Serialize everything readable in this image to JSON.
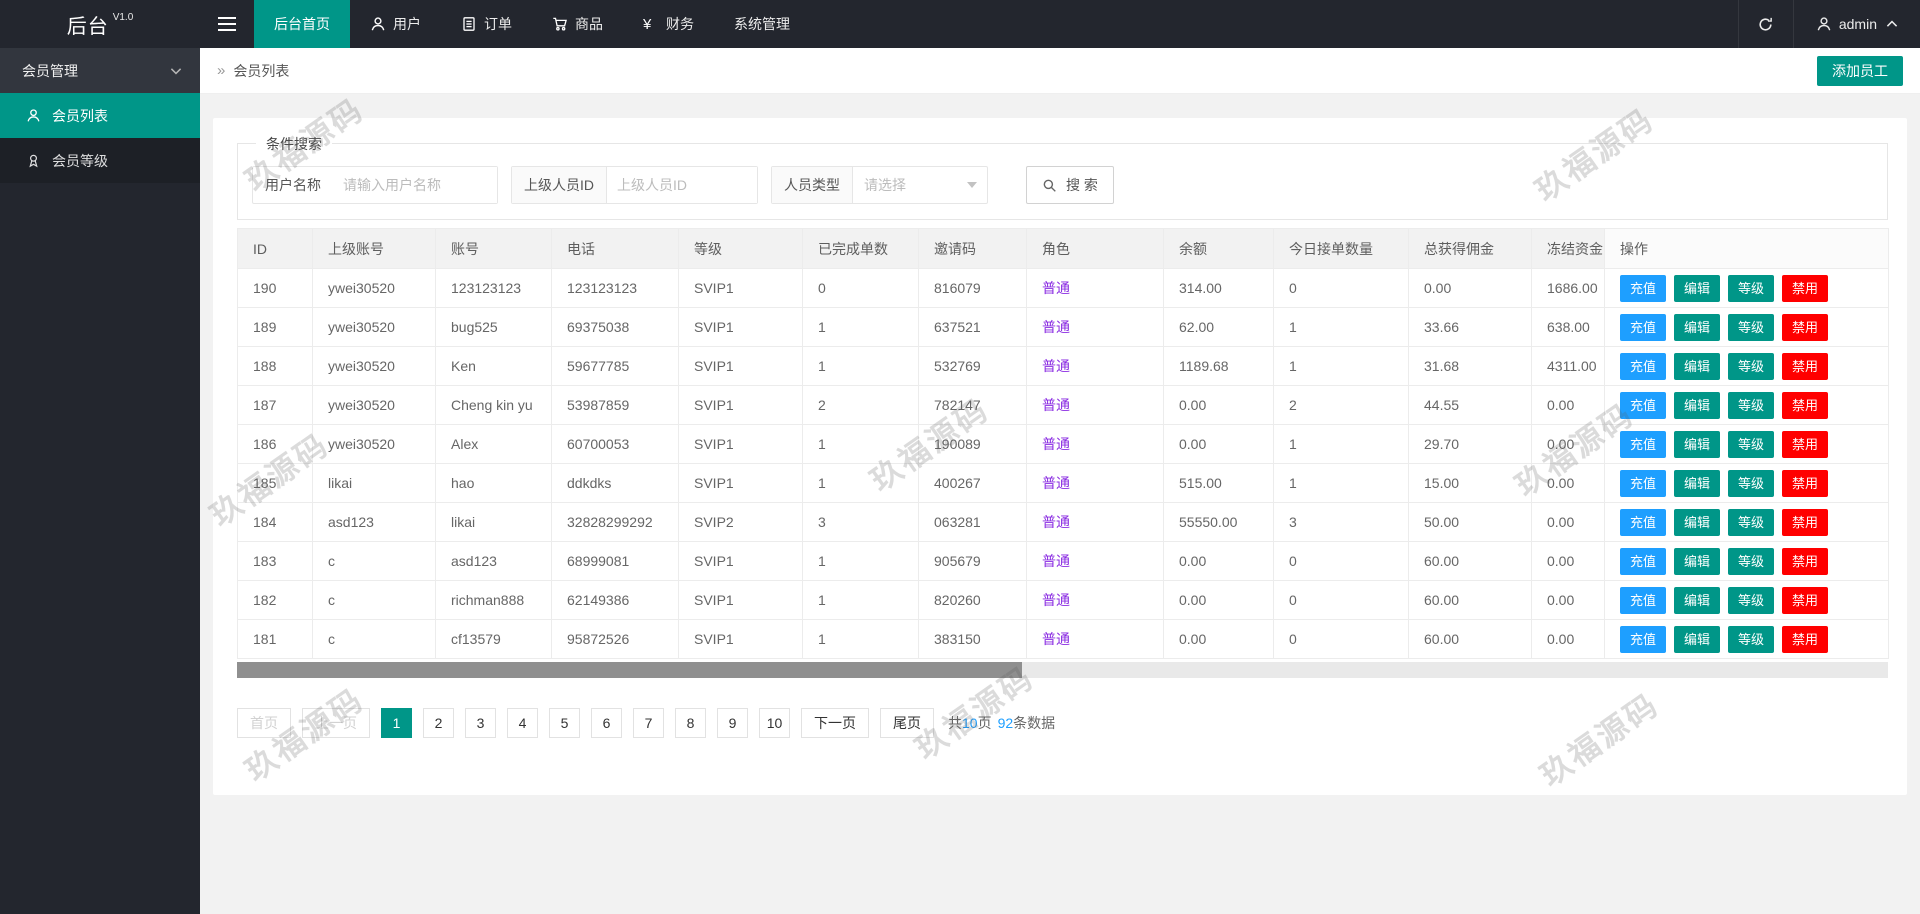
{
  "app": {
    "name": "后台",
    "version": "V1.0"
  },
  "navbar": {
    "items": [
      {
        "label": "后台首页",
        "icon": "",
        "active": true
      },
      {
        "label": "用户",
        "icon": "user",
        "active": false
      },
      {
        "label": "订单",
        "icon": "document",
        "active": false
      },
      {
        "label": "商品",
        "icon": "cart",
        "active": false
      },
      {
        "label": "财务",
        "icon": "yen",
        "active": false
      },
      {
        "label": "系统管理",
        "icon": "",
        "active": false
      }
    ],
    "user": {
      "name": "admin"
    }
  },
  "sidebar": {
    "groups": [
      {
        "label": "会员管理",
        "items": [
          {
            "label": "会员列表",
            "icon": "user",
            "active": true
          },
          {
            "label": "会员等级",
            "icon": "medal",
            "active": false
          }
        ]
      }
    ]
  },
  "breadcrumb": {
    "separator": "»",
    "label": "会员列表"
  },
  "toolbar": {
    "add_button": "添加员工"
  },
  "search": {
    "legend": "条件搜索",
    "fields": [
      {
        "label": "用户名称",
        "placeholder": "请输入用户名称",
        "type": "text"
      },
      {
        "label": "上级人员ID",
        "placeholder": "上级人员ID",
        "type": "text"
      },
      {
        "label": "人员类型",
        "placeholder": "请选择",
        "type": "select"
      }
    ],
    "button_label": "搜 索"
  },
  "table": {
    "columns": [
      "ID",
      "上级账号",
      "账号",
      "电话",
      "等级",
      "已完成单数",
      "邀请码",
      "角色",
      "余额",
      "今日接单数量",
      "总获得佣金",
      "冻结资金",
      "操作"
    ],
    "action_labels": [
      "充值",
      "编辑",
      "等级",
      "禁用"
    ],
    "rows": [
      {
        "id": "190",
        "parent_account": "ywei30520",
        "account": "123123123",
        "phone": "123123123",
        "level": "SVIP1",
        "completed_orders": "0",
        "invite_code": "816079",
        "role": "普通",
        "balance": "314.00",
        "today_orders": "0",
        "total_commission": "0.00",
        "frozen_funds": "1686.00"
      },
      {
        "id": "189",
        "parent_account": "ywei30520",
        "account": "bug525",
        "phone": "69375038",
        "level": "SVIP1",
        "completed_orders": "1",
        "invite_code": "637521",
        "role": "普通",
        "balance": "62.00",
        "today_orders": "1",
        "total_commission": "33.66",
        "frozen_funds": "638.00"
      },
      {
        "id": "188",
        "parent_account": "ywei30520",
        "account": "Ken",
        "phone": "59677785",
        "level": "SVIP1",
        "completed_orders": "1",
        "invite_code": "532769",
        "role": "普通",
        "balance": "1189.68",
        "today_orders": "1",
        "total_commission": "31.68",
        "frozen_funds": "4311.00"
      },
      {
        "id": "187",
        "parent_account": "ywei30520",
        "account": "Cheng kin yu",
        "phone": "53987859",
        "level": "SVIP1",
        "completed_orders": "2",
        "invite_code": "782147",
        "role": "普通",
        "balance": "0.00",
        "today_orders": "2",
        "total_commission": "44.55",
        "frozen_funds": "0.00"
      },
      {
        "id": "186",
        "parent_account": "ywei30520",
        "account": "Alex",
        "phone": "60700053",
        "level": "SVIP1",
        "completed_orders": "1",
        "invite_code": "190089",
        "role": "普通",
        "balance": "0.00",
        "today_orders": "1",
        "total_commission": "29.70",
        "frozen_funds": "0.00"
      },
      {
        "id": "185",
        "parent_account": "likai",
        "account": "hao",
        "phone": "ddkdks",
        "level": "SVIP1",
        "completed_orders": "1",
        "invite_code": "400267",
        "role": "普通",
        "balance": "515.00",
        "today_orders": "1",
        "total_commission": "15.00",
        "frozen_funds": "0.00"
      },
      {
        "id": "184",
        "parent_account": "asd123",
        "account": "likai",
        "phone": "32828299292",
        "level": "SVIP2",
        "completed_orders": "3",
        "invite_code": "063281",
        "role": "普通",
        "balance": "55550.00",
        "today_orders": "3",
        "total_commission": "50.00",
        "frozen_funds": "0.00"
      },
      {
        "id": "183",
        "parent_account": "c",
        "account": "asd123",
        "phone": "68999081",
        "level": "SVIP1",
        "completed_orders": "1",
        "invite_code": "905679",
        "role": "普通",
        "balance": "0.00",
        "today_orders": "0",
        "total_commission": "60.00",
        "frozen_funds": "0.00"
      },
      {
        "id": "182",
        "parent_account": "c",
        "account": "richman888",
        "phone": "62149386",
        "level": "SVIP1",
        "completed_orders": "1",
        "invite_code": "820260",
        "role": "普通",
        "balance": "0.00",
        "today_orders": "0",
        "total_commission": "60.00",
        "frozen_funds": "0.00"
      },
      {
        "id": "181",
        "parent_account": "c",
        "account": "cf13579",
        "phone": "95872526",
        "level": "SVIP1",
        "completed_orders": "1",
        "invite_code": "383150",
        "role": "普通",
        "balance": "0.00",
        "today_orders": "0",
        "total_commission": "60.00",
        "frozen_funds": "0.00"
      }
    ]
  },
  "pagination": {
    "first": "首页",
    "prev": "上一页",
    "pages": [
      "1",
      "2",
      "3",
      "4",
      "5",
      "6",
      "7",
      "8",
      "9",
      "10"
    ],
    "active_page": "1",
    "next": "下一页",
    "last": "尾页",
    "summary": {
      "prefix": "共",
      "total_pages": "10",
      "pages_unit": "页",
      "total_records": "92",
      "records_unit": "条数据"
    }
  },
  "watermark": {
    "text": "玖福源码"
  },
  "colors": {
    "primary": "#009688",
    "blue": "#1E9FFF",
    "red": "#FF0000",
    "purple": "#8A2BE2",
    "navbar_bg": "#23262E"
  }
}
